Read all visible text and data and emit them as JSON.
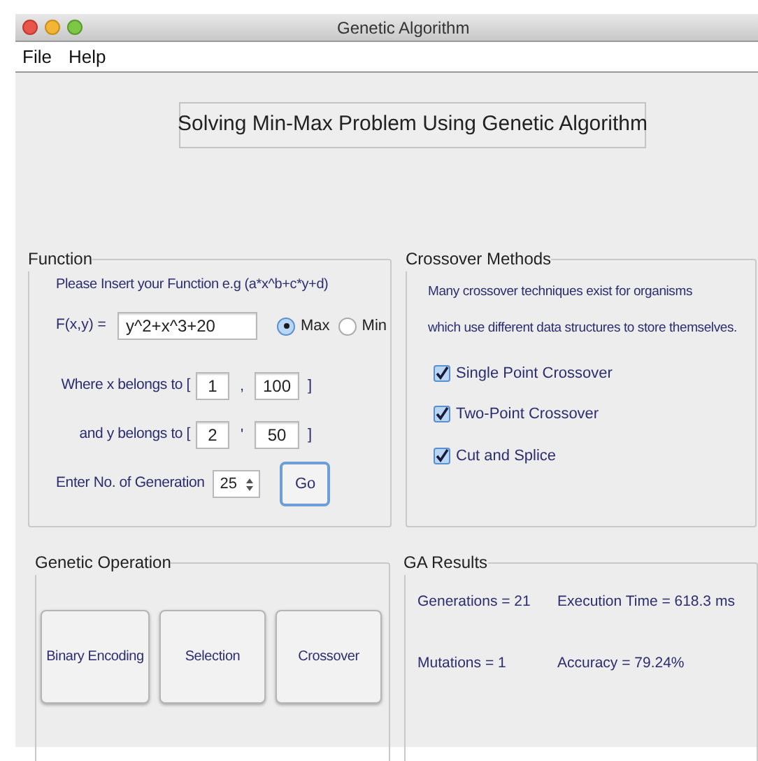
{
  "window": {
    "title": "Genetic Algorithm"
  },
  "menu": [
    {
      "label": "File"
    },
    {
      "label": "Help"
    }
  ],
  "heading": "Solving Min-Max Problem Using Genetic Algorithm",
  "function_panel": {
    "legend": "Function",
    "instruction": "Please Insert your Function e.g (a*x^b+c*y+d)",
    "function_label": "F(x,y) =",
    "function_value": "y^2+x^3+20",
    "radios": [
      {
        "label": "Max",
        "selected": true
      },
      {
        "label": "Min",
        "selected": false
      }
    ],
    "ranges": [
      {
        "label": "Where x belongs to [",
        "from": "1",
        "separator": ",",
        "to": "100",
        "close": "]"
      },
      {
        "label": "and y belongs to [",
        "from": "2",
        "separator": "'",
        "to": "50",
        "close": "]"
      }
    ],
    "generation": {
      "label": "Enter No. of Generation",
      "value": "25"
    },
    "go_button": "Go"
  },
  "crossover_panel": {
    "legend": "Crossover Methods",
    "description": [
      "Many crossover techniques exist for organisms",
      "which use different data structures to store themselves."
    ],
    "methods": [
      {
        "label": "Single Point Crossover",
        "checked": true
      },
      {
        "label": "Two-Point Crossover",
        "checked": true
      },
      {
        "label": "Cut and Splice",
        "checked": true
      }
    ]
  },
  "operation_panel": {
    "legend": "Genetic Operation",
    "buttons": [
      "Binary Encoding",
      "Selection",
      "Crossover"
    ]
  },
  "results_panel": {
    "legend": "GA Results",
    "rows": [
      [
        "Generations = 21",
        "Execution Time = 618.3 ms"
      ],
      [
        "Mutations = 1",
        "Accuracy = 79.24%"
      ]
    ]
  }
}
